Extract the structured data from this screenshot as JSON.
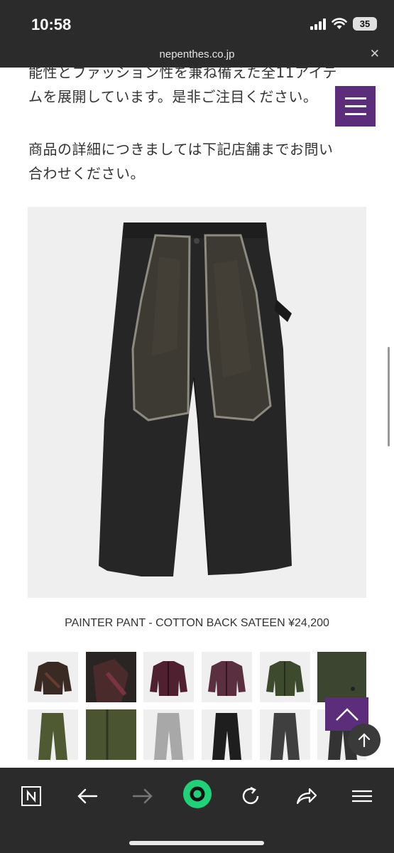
{
  "status": {
    "time": "10:58",
    "battery": "35"
  },
  "browser": {
    "url": "nepenthes.co.jp"
  },
  "article": {
    "paragraph1": "能性とファッション性を兼ね備えた全11アイテムを展開しています。是非ご注目ください。",
    "paragraph2": "商品の詳細につきましては下記店舗までお問い合わせください。"
  },
  "product": {
    "caption": "PAINTER PANT - COTTON BACK SATEEN ¥24,200"
  },
  "thumbnails": {
    "row1": [
      "jacket-brown",
      "jacket-detail",
      "jacket-maroon",
      "jacket-purple",
      "jacket-olive",
      "bag-olive"
    ],
    "row2": [
      "pant-olive",
      "pant-olive-detail",
      "pant-grey",
      "pant-black",
      "pant-charcoal",
      "pant-charcoal-2"
    ]
  },
  "colors": {
    "accent": "#5b2d7a",
    "toolbar": "#2b2b2b",
    "go_button": "#1fd27a"
  },
  "icons": {
    "toolbar": [
      "naver-n-icon",
      "back-arrow-icon",
      "forward-arrow-icon",
      "green-circle-icon",
      "reload-icon",
      "share-icon",
      "hamburger-icon"
    ]
  }
}
